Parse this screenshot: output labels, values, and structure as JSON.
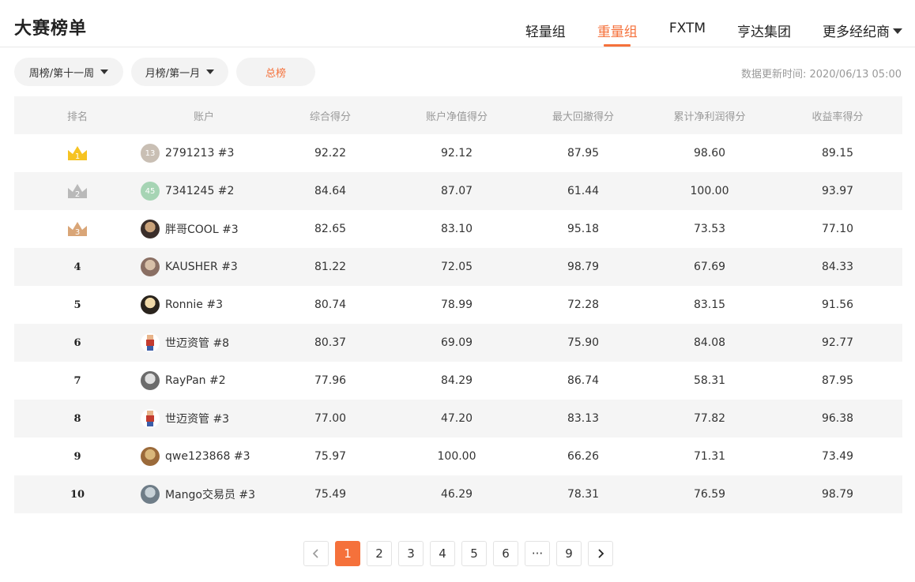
{
  "header": {
    "title": "大赛榜单",
    "tabs": [
      {
        "label": "轻量组",
        "active": false
      },
      {
        "label": "重量组",
        "active": true
      },
      {
        "label": "FXTM",
        "active": false
      },
      {
        "label": "亨达集团",
        "active": false
      },
      {
        "label": "更多经纪商",
        "active": false,
        "dropdown": true
      }
    ]
  },
  "filters": {
    "weekly": "周榜/第十一周",
    "monthly": "月榜/第一月",
    "total": "总榜",
    "update_time": "数据更新时间: 2020/06/13 05:00"
  },
  "table": {
    "columns": [
      "排名",
      "账户",
      "综合得分",
      "账户净值得分",
      "最大回撤得分",
      "累计净利润得分",
      "收益率得分"
    ],
    "rows": [
      {
        "rank": "1",
        "crown": "gold",
        "avatar": {
          "type": "badge",
          "text": "13",
          "color": "#c9bfb4"
        },
        "account": "2791213 #3",
        "total": "92.22",
        "equity": "92.12",
        "drawdown": "87.95",
        "profit": "98.60",
        "yield": "89.15"
      },
      {
        "rank": "2",
        "crown": "silver",
        "avatar": {
          "type": "badge",
          "text": "45",
          "color": "#a6d4b4"
        },
        "account": "7341245 #2",
        "total": "84.64",
        "equity": "87.07",
        "drawdown": "61.44",
        "profit": "100.00",
        "yield": "93.97"
      },
      {
        "rank": "3",
        "crown": "bronze",
        "avatar": {
          "type": "photo",
          "color": "#3a2e2a",
          "color2": "#c9a27a"
        },
        "account": "胖哥COOL #3",
        "total": "82.65",
        "equity": "83.10",
        "drawdown": "95.18",
        "profit": "73.53",
        "yield": "77.10"
      },
      {
        "rank": "4",
        "crown": "",
        "avatar": {
          "type": "photo",
          "color": "#8a6f63",
          "color2": "#d8c0a8"
        },
        "account": "KAUSHER #3",
        "total": "81.22",
        "equity": "72.05",
        "drawdown": "98.79",
        "profit": "67.69",
        "yield": "84.33"
      },
      {
        "rank": "5",
        "crown": "",
        "avatar": {
          "type": "photo",
          "color": "#2a241d",
          "color2": "#f0d9a8"
        },
        "account": "Ronnie #3",
        "total": "80.74",
        "equity": "78.99",
        "drawdown": "72.28",
        "profit": "83.15",
        "yield": "91.56"
      },
      {
        "rank": "6",
        "crown": "",
        "avatar": {
          "type": "figure",
          "color": "#c33b2f",
          "color2": "#3b5da8"
        },
        "account": "世迈资管 #8",
        "total": "80.37",
        "equity": "69.09",
        "drawdown": "75.90",
        "profit": "84.08",
        "yield": "92.77"
      },
      {
        "rank": "7",
        "crown": "",
        "avatar": {
          "type": "photo",
          "color": "#6c6c6c",
          "color2": "#e0e0e0"
        },
        "account": "RayPan #2",
        "total": "77.96",
        "equity": "84.29",
        "drawdown": "86.74",
        "profit": "58.31",
        "yield": "87.95"
      },
      {
        "rank": "8",
        "crown": "",
        "avatar": {
          "type": "figure",
          "color": "#c33b2f",
          "color2": "#3b5da8"
        },
        "account": "世迈资管 #3",
        "total": "77.00",
        "equity": "47.20",
        "drawdown": "83.13",
        "profit": "77.82",
        "yield": "96.38"
      },
      {
        "rank": "9",
        "crown": "",
        "avatar": {
          "type": "photo",
          "color": "#9b6a3a",
          "color2": "#d9b77a"
        },
        "account": "qwe123868 #3",
        "total": "75.97",
        "equity": "100.00",
        "drawdown": "66.26",
        "profit": "71.31",
        "yield": "73.49"
      },
      {
        "rank": "10",
        "crown": "",
        "avatar": {
          "type": "photo",
          "color": "#6f7d88",
          "color2": "#c8d2d8"
        },
        "account": "Mango交易员 #3",
        "total": "75.49",
        "equity": "46.29",
        "drawdown": "78.31",
        "profit": "76.59",
        "yield": "98.79"
      }
    ]
  },
  "pagination": {
    "prev_icon": "chevron-left-icon",
    "next_icon": "chevron-right-icon",
    "pages": [
      "1",
      "2",
      "3",
      "4",
      "5",
      "6",
      "···",
      "9"
    ],
    "current": "1"
  },
  "colors": {
    "accent": "#f5713b",
    "gold": "#f6c322",
    "silver": "#b9b9b9",
    "bronze": "#d9a577"
  }
}
